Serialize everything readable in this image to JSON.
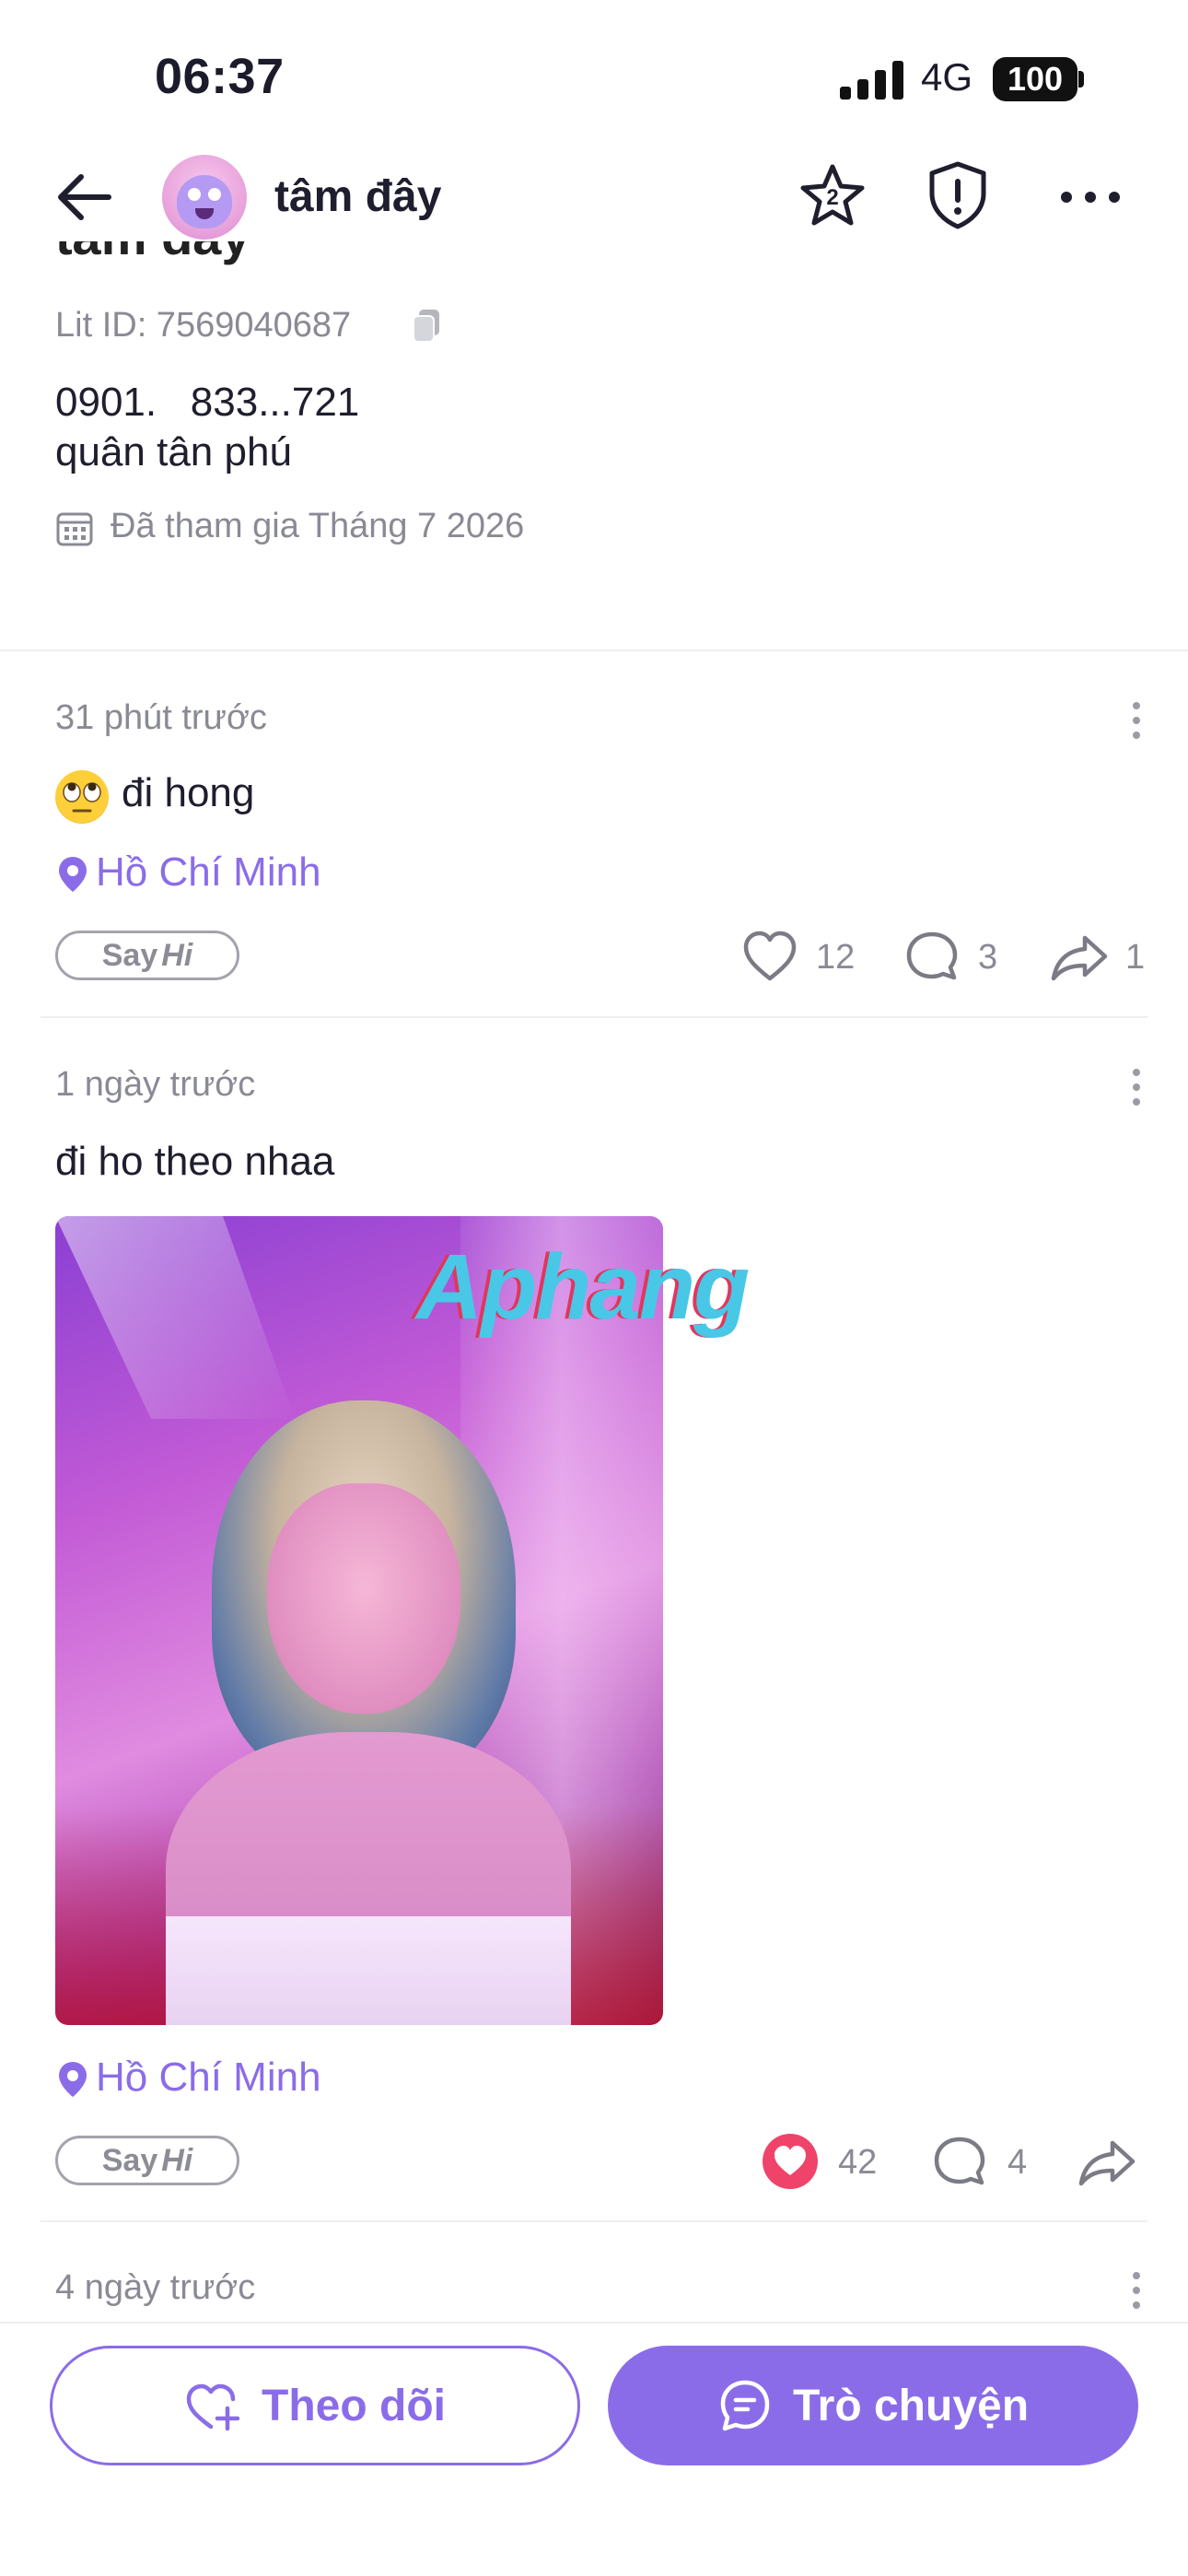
{
  "status_bar": {
    "time": "06:37",
    "network": "4G",
    "battery": "100"
  },
  "header": {
    "username": "tâm đây"
  },
  "profile": {
    "lit_id": "Lit ID: 7569040687",
    "bio_line1": "0901.   833...721",
    "bio_line2": "quân tân phú",
    "joined": "Đã tham gia Tháng 7 2026"
  },
  "posts": [
    {
      "timestamp": "31 phút trước",
      "text": "đi hong",
      "emoji": "face-with-rolling-eyes",
      "location": "Hồ Chí Minh",
      "sayhi_say": "Say",
      "sayhi_hi": "Hi",
      "likes": "12",
      "comments": "3",
      "shares": "1",
      "liked": false
    },
    {
      "timestamp": "1 ngày trước",
      "text": "đi ho theo nhaa",
      "location": "Hồ Chí Minh",
      "sayhi_say": "Say",
      "sayhi_hi": "Hi",
      "likes": "42",
      "comments": "4",
      "liked": true,
      "watermark": "Aphang"
    },
    {
      "timestamp": "4 ngày trước"
    }
  ],
  "footer": {
    "follow_label": "Theo dõi",
    "chat_label": "Trò chuyện"
  },
  "colors": {
    "accent": "#8b6ce8",
    "like_active": "#f0436a",
    "muted": "#8a8a95"
  }
}
